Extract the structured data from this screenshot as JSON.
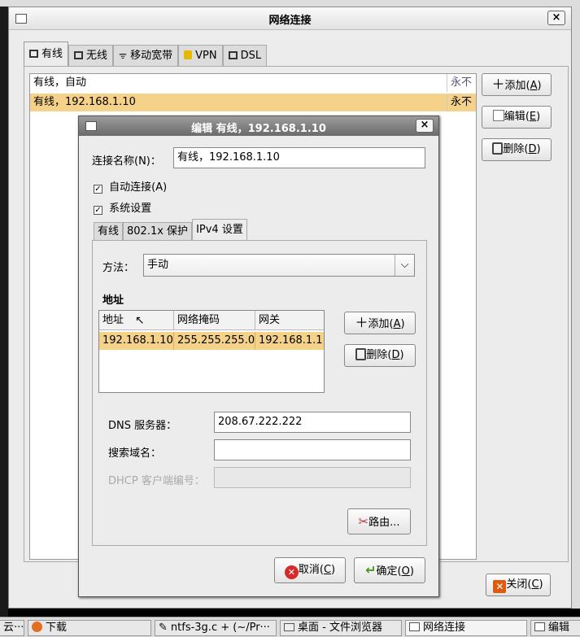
{
  "window": {
    "title": "网络连接",
    "close_glyph": "×",
    "tabs": [
      {
        "label": "有线"
      },
      {
        "label": "无线"
      },
      {
        "label": "移动宽带"
      },
      {
        "label": "VPN"
      },
      {
        "label": "DSL"
      }
    ],
    "connections": [
      {
        "name": "有线，自动",
        "last_used": "永不"
      },
      {
        "name": "有线，192.168.1.10",
        "last_used": "永不"
      }
    ],
    "buttons": {
      "add": "添加",
      "add_key": "A",
      "edit": "编辑",
      "edit_key": "E",
      "delete": "删除",
      "delete_key": "D",
      "close": "关闭",
      "close_key": "C"
    }
  },
  "dialog": {
    "title": "编辑 有线，192.168.1.10",
    "close_glyph": "×",
    "conn_name_label": "连接名称(N)：",
    "conn_name_value": "有线，192.168.1.10",
    "auto_connect_label": "自动连接(A)",
    "system_settings_label": "系统设置",
    "check_glyph": "✓",
    "tabs": [
      {
        "label": "有线"
      },
      {
        "label": "802.1x 保护"
      },
      {
        "label": "IPv4 设置"
      }
    ],
    "method_label": "方法：",
    "method_value": "手动",
    "address_section": "地址",
    "table": {
      "columns": [
        "地址",
        "网络掩码",
        "网关"
      ],
      "rows": [
        [
          "192.168.1.10",
          "255.255.255.0",
          "192.168.1.1"
        ]
      ]
    },
    "add_button": "添加",
    "add_key": "A",
    "delete_button": "删除",
    "delete_key": "D",
    "dns_label": "DNS 服务器：",
    "dns_value": "208.67.222.222",
    "search_domain_label": "搜索域名：",
    "search_domain_value": "",
    "dhcp_label": "DHCP 客户端编号：",
    "dhcp_value": "",
    "routes_button": "路由...",
    "cancel_button": "取消",
    "cancel_key": "C",
    "ok_button": "确定",
    "ok_key": "O"
  },
  "taskbar": {
    "items": [
      {
        "label": "云···"
      },
      {
        "label": "下载"
      },
      {
        "label": "ntfs-3g.c + (~/Pr···"
      },
      {
        "label": "桌面 - 文件浏览器"
      },
      {
        "label": "网络连接"
      },
      {
        "label": "编辑"
      }
    ]
  },
  "colors": {
    "selection": "#f5d28a",
    "dialog_title": "#6b6b6b",
    "cancel_icon": "#d42a2a",
    "ok_icon": "#4a9a2a"
  }
}
